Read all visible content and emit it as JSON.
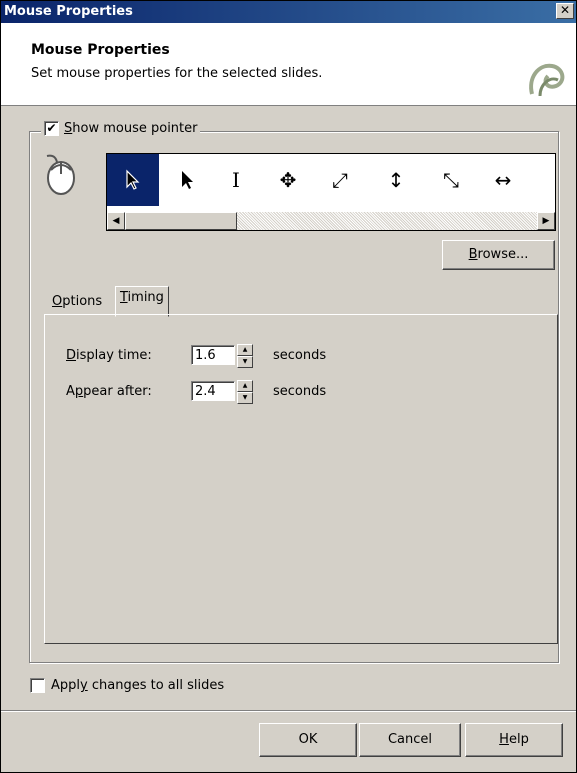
{
  "window": {
    "title": "Mouse Properties",
    "close_glyph": "✕"
  },
  "header": {
    "title": "Mouse Properties",
    "subtitle": "Set mouse properties for the selected slides."
  },
  "show_pointer": {
    "checked": true,
    "label": "Show mouse pointer"
  },
  "pointers": [
    {
      "name": "arrow-selected",
      "glyph": "🡼"
    },
    {
      "name": "arrow",
      "glyph": "🡼"
    },
    {
      "name": "ibeam",
      "glyph": "I"
    },
    {
      "name": "move",
      "glyph": "✥"
    },
    {
      "name": "resize-nesw",
      "glyph": "⤢"
    },
    {
      "name": "resize-vertical",
      "glyph": "↕"
    },
    {
      "name": "resize-nwse",
      "glyph": "⤡"
    },
    {
      "name": "resize-horizontal",
      "glyph": "↔"
    }
  ],
  "browse_label": "Browse...",
  "tabs": [
    {
      "label": "Options",
      "active": false
    },
    {
      "label": "Timing",
      "active": true
    }
  ],
  "timing": {
    "display_time_label": "Display time:",
    "display_time_value": "1.6",
    "appear_after_label": "Appear after:",
    "appear_after_value": "2.4",
    "unit": "seconds"
  },
  "apply_all": {
    "checked": false,
    "label": "Apply changes to all slides"
  },
  "buttons": {
    "ok": "OK",
    "cancel": "Cancel",
    "help": "Help"
  },
  "colors": {
    "selection": "#0a246a",
    "dialog_bg": "#d4d0c8"
  }
}
